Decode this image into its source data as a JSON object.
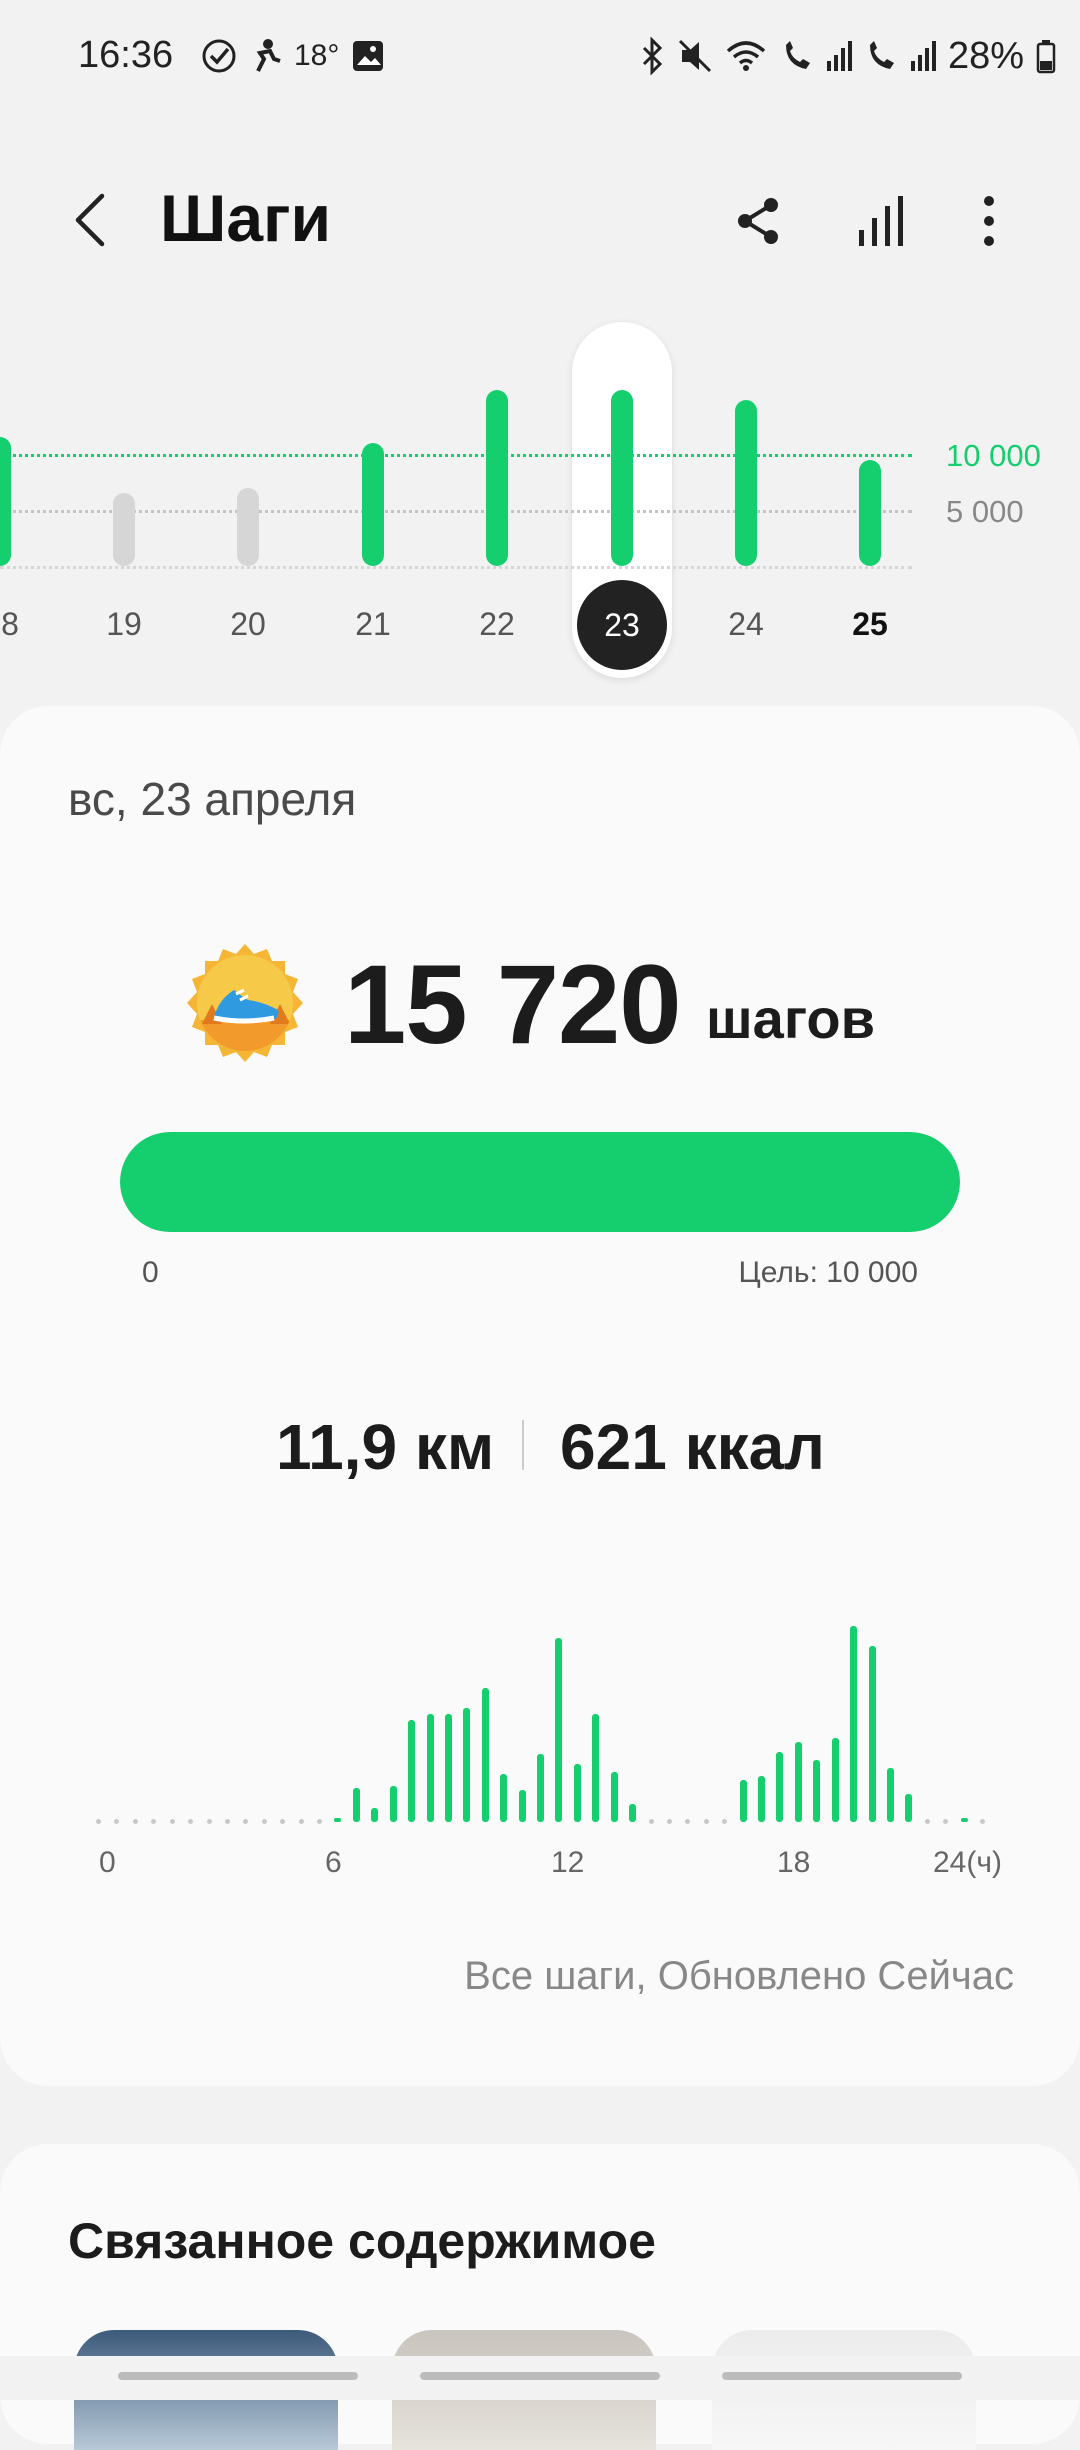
{
  "status_bar": {
    "time": "16:36",
    "temperature": "18°",
    "battery": "28%",
    "icons": [
      "check-circle-icon",
      "runner-icon",
      "image-icon",
      "bluetooth-icon",
      "mute-icon",
      "wifi-icon",
      "call-sim1-icon",
      "signal-icon",
      "call-sim2-icon",
      "signal-icon",
      "battery-icon"
    ]
  },
  "header": {
    "title": "Шаги",
    "icons": [
      "back-arrow-icon",
      "share-icon",
      "bar-chart-icon",
      "more-vertical-icon"
    ]
  },
  "week_chart": {
    "days": [
      "8",
      "19",
      "20",
      "21",
      "22",
      "23",
      "24",
      "25"
    ],
    "selected_day": "23",
    "bold_day": "25",
    "values": [
      11500,
      6500,
      7000,
      11000,
      15700,
      15720,
      14800,
      9500
    ],
    "goal_reached": [
      true,
      false,
      false,
      true,
      true,
      true,
      true,
      true
    ],
    "goal_label": "10 000",
    "mid_label": "5 000",
    "colors": {
      "reached": "#15cf6f",
      "not_reached": "#d6d6d6",
      "goal_line": "#15cf6f",
      "mid_line": "#bdbdbd"
    }
  },
  "summary": {
    "date": "вс, 23 апреля",
    "steps": "15 720",
    "steps_unit": "шагов",
    "progress_fraction": 1.0,
    "progress_start": "0",
    "progress_goal": "Цель: 10 000",
    "distance": "11,9 км",
    "calories": "621 ккал",
    "medal_icon": "sneaker-medal-icon"
  },
  "hourly_chart": {
    "x_labels": [
      "0",
      "6",
      "12",
      "18",
      "24(ч)"
    ],
    "bars": [
      {
        "h": 6.5,
        "v": 2
      },
      {
        "h": 7,
        "v": 17
      },
      {
        "h": 7.5,
        "v": 7
      },
      {
        "h": 8,
        "v": 18
      },
      {
        "h": 8.5,
        "v": 51
      },
      {
        "h": 9,
        "v": 54
      },
      {
        "h": 9.5,
        "v": 54
      },
      {
        "h": 10,
        "v": 57
      },
      {
        "h": 10.5,
        "v": 67
      },
      {
        "h": 11,
        "v": 24
      },
      {
        "h": 11.5,
        "v": 16
      },
      {
        "h": 12,
        "v": 34
      },
      {
        "h": 12.5,
        "v": 92
      },
      {
        "h": 13,
        "v": 29
      },
      {
        "h": 13.5,
        "v": 54
      },
      {
        "h": 14,
        "v": 25
      },
      {
        "h": 14.5,
        "v": 9
      },
      {
        "h": 17.5,
        "v": 21
      },
      {
        "h": 18,
        "v": 23
      },
      {
        "h": 18.5,
        "v": 35
      },
      {
        "h": 19,
        "v": 40
      },
      {
        "h": 19.5,
        "v": 31
      },
      {
        "h": 20,
        "v": 42
      },
      {
        "h": 20.5,
        "v": 98
      },
      {
        "h": 21,
        "v": 88
      },
      {
        "h": 21.5,
        "v": 27
      },
      {
        "h": 22,
        "v": 14
      },
      {
        "h": 23.5,
        "v": 2
      }
    ],
    "color": "#15cf6f"
  },
  "footer": {
    "updated": "Все шаги, Обновлено Сейчас",
    "related_title": "Связанное содержимое"
  }
}
